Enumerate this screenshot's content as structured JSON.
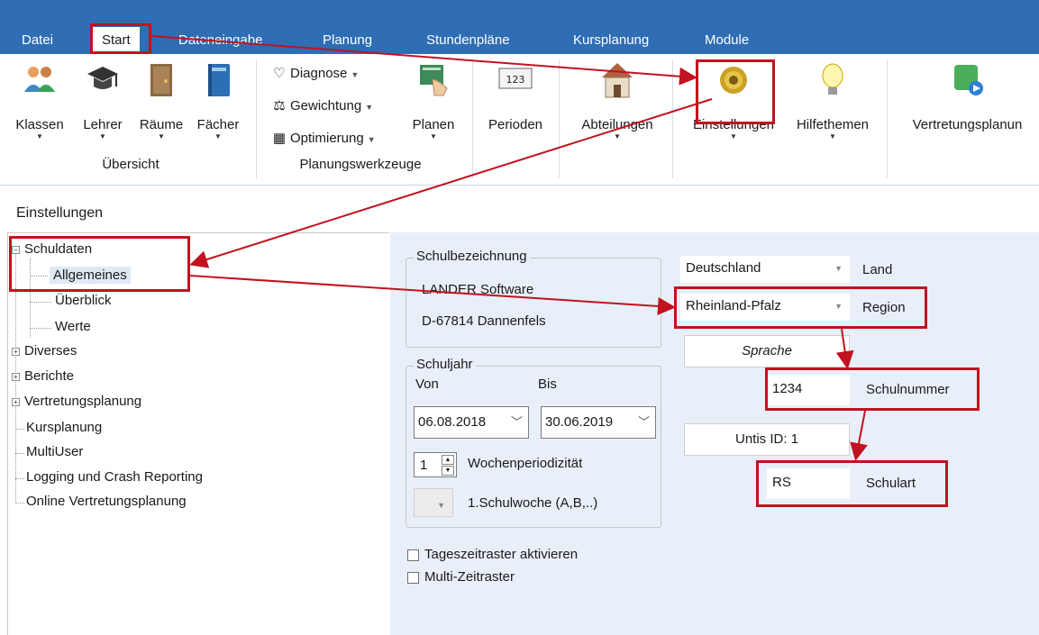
{
  "tabs": [
    "Datei",
    "Start",
    "Dateneingabe",
    "Planung",
    "Stundenpläne",
    "Kursplanung",
    "Module"
  ],
  "ribbon": {
    "uebersicht_buttons": [
      "Klassen",
      "Lehrer",
      "Räume",
      "Fächer"
    ],
    "uebersicht_label": "Übersicht",
    "tools": [
      "Diagnose",
      "Gewichtung",
      "Optimierung"
    ],
    "planen": "Planen",
    "perioden": "Perioden",
    "abteilungen": "Abteilungen",
    "einstellungen": "Einstellungen",
    "hilfethemen": "Hilfethemen",
    "vertretungsplanung": "Vertretungsplanun",
    "planungswerkzeuge_label": "Planungswerkzeuge",
    "perioden_icon_text": "123"
  },
  "page_title": "Einstellungen",
  "tree": {
    "schuldaten": "Schuldaten",
    "allgemeines": "Allgemeines",
    "ueberblick": "Überblick",
    "werte": "Werte",
    "diverses": "Diverses",
    "berichte": "Berichte",
    "vertretungsplanung": "Vertretungsplanung",
    "kursplanung": "Kursplanung",
    "multiuser": "MultiUser",
    "logging": "Logging und Crash Reporting",
    "online": "Online Vertretungsplanung"
  },
  "school": {
    "group_title": "Schulbezeichnung",
    "name": "LANDER Software",
    "address": "D-67814 Dannenfels"
  },
  "schuljahr": {
    "group_title": "Schuljahr",
    "von_label": "Von",
    "bis_label": "Bis",
    "von": "06.08.2018",
    "bis": "30.06.2019",
    "periodicity_value": "1",
    "periodicity_label": "Wochenperiodizität",
    "schulwoche_label": "1.Schulwoche (A,B,..)"
  },
  "checkboxes": {
    "tageszeitraster": "Tageszeitraster aktivieren",
    "multi": "Multi-Zeitraster"
  },
  "right": {
    "land_value": "Deutschland",
    "land_label": "Land",
    "region_value": "Rheinland-Pfalz",
    "region_label": "Region",
    "sprache": "Sprache",
    "schulnummer_value": "1234",
    "schulnummer_label": "Schulnummer",
    "untis_id": "Untis ID: 1",
    "schulart_value": "RS",
    "schulart_label": "Schulart"
  },
  "colors": {
    "tabbar": "#2f6db4",
    "panel": "#e8eff8",
    "highlight_red": "#c1121f"
  }
}
